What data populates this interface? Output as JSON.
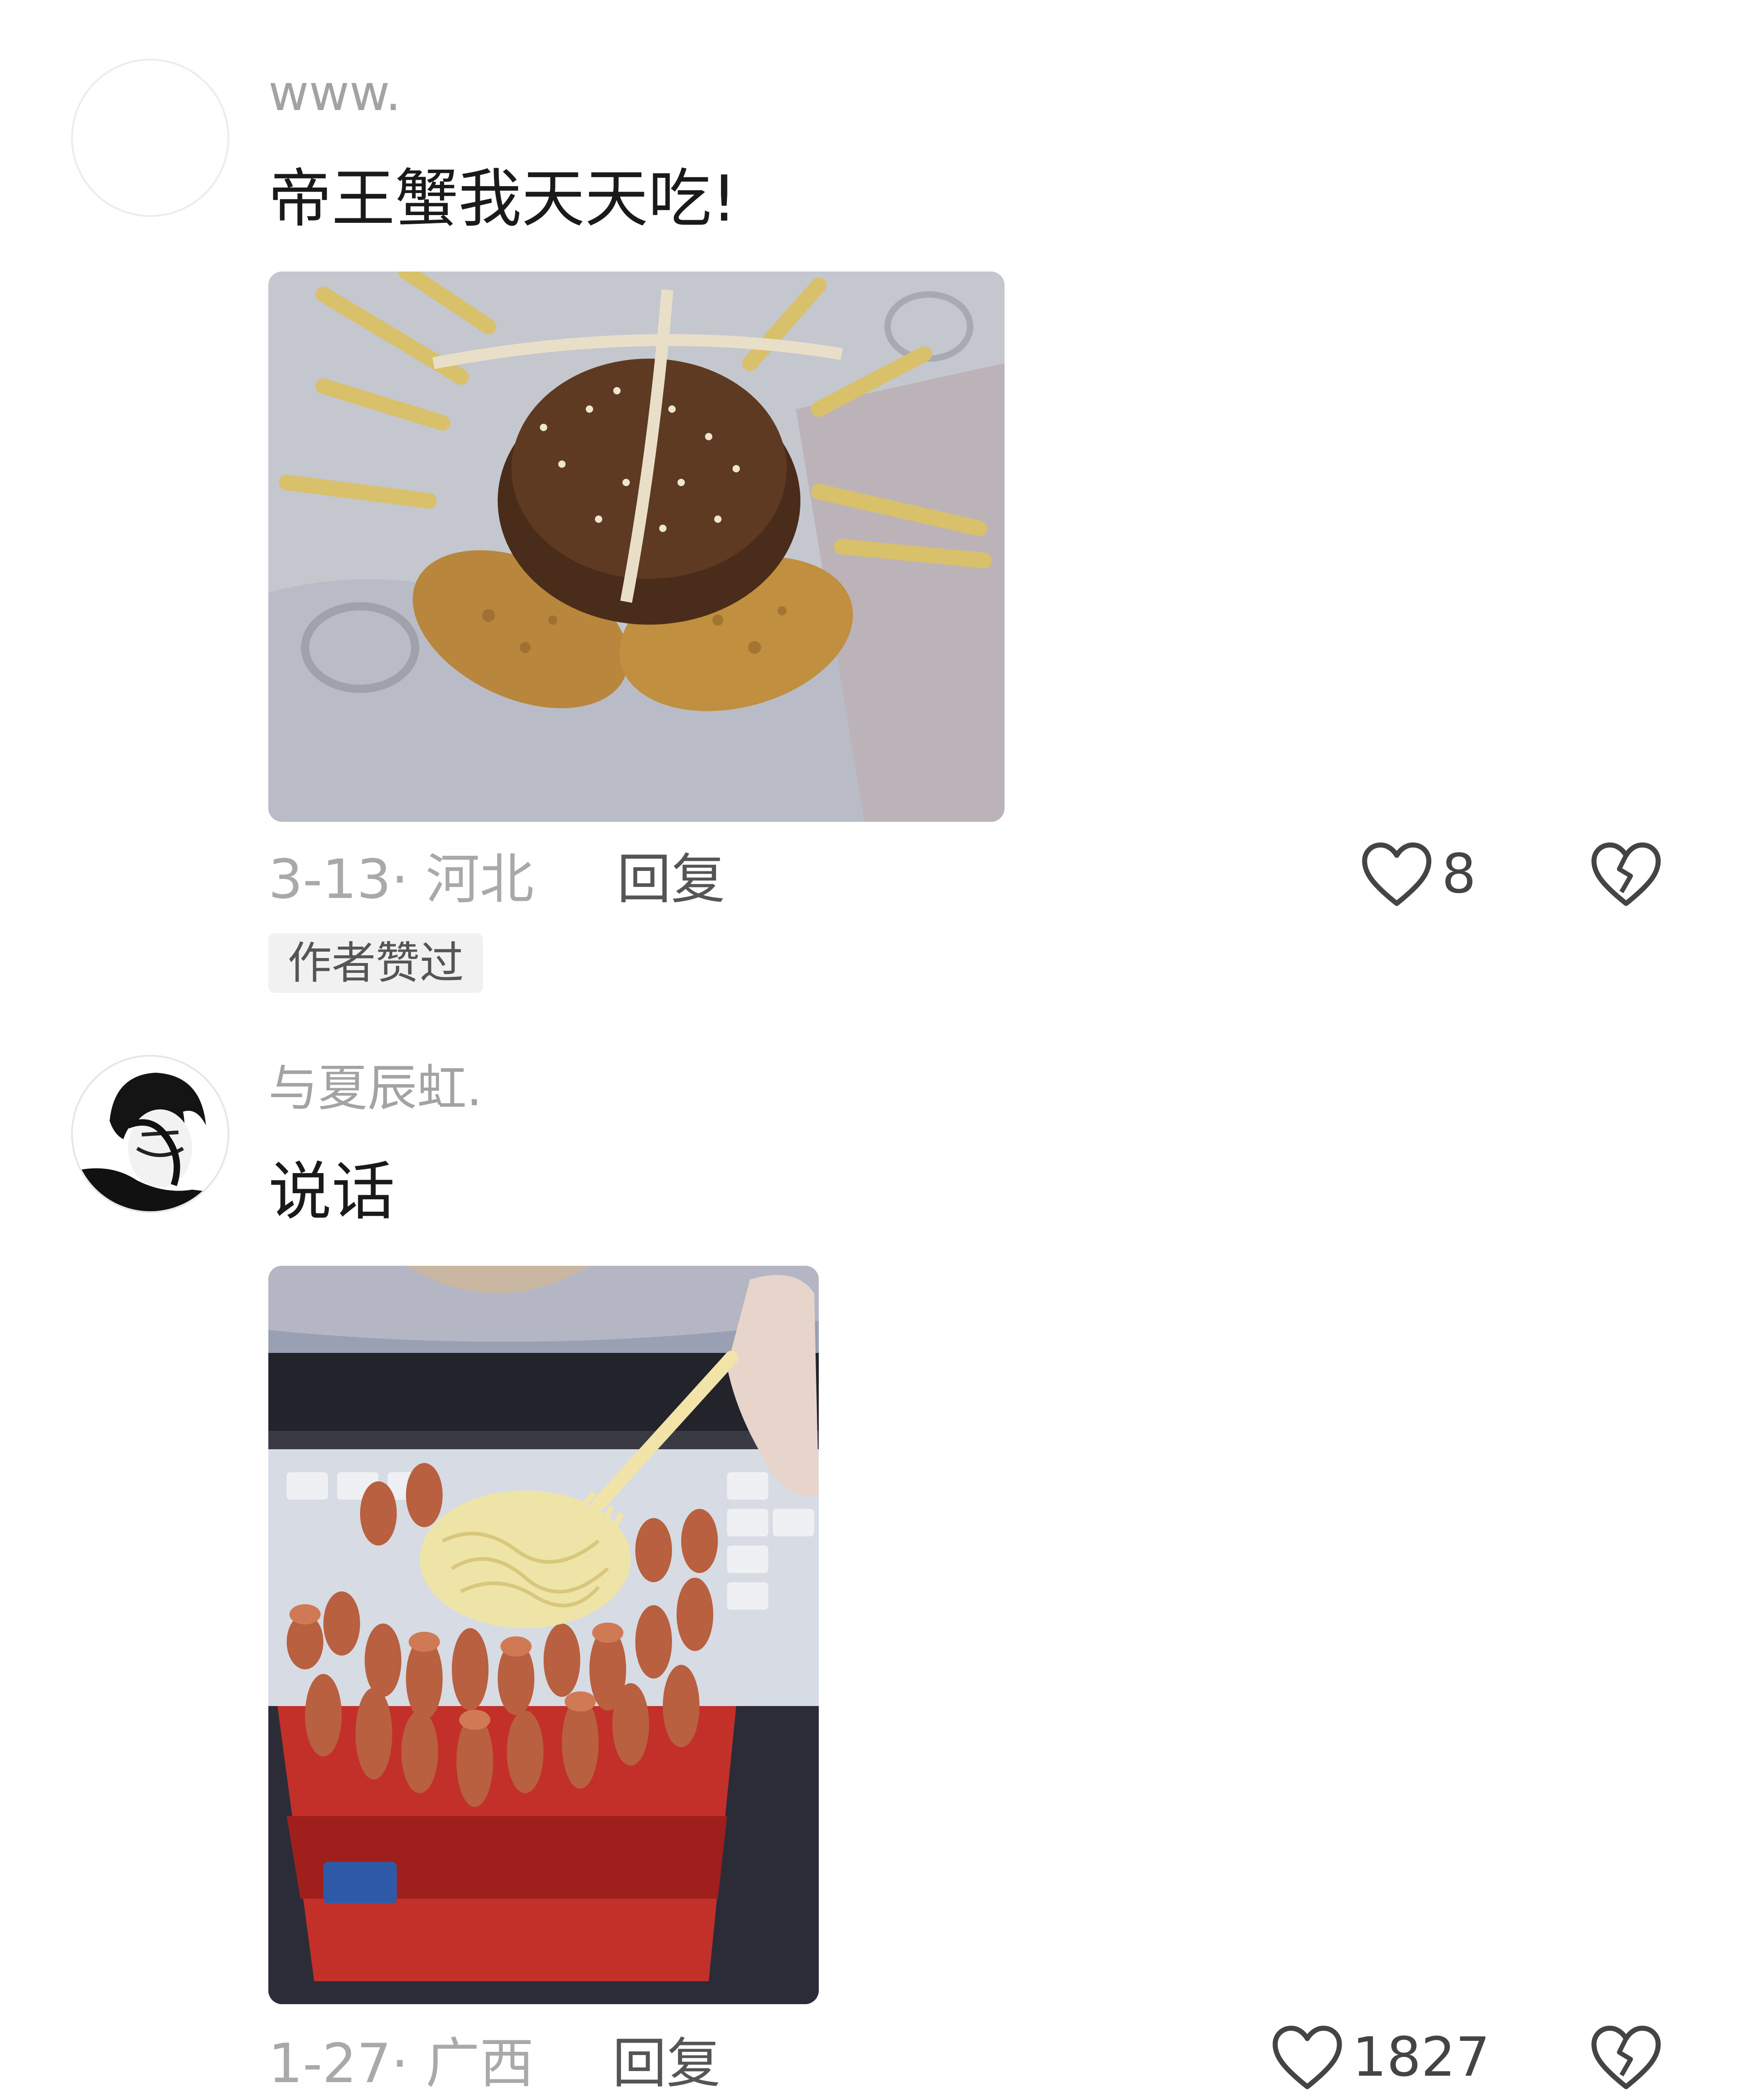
{
  "comments": [
    {
      "username": "www.",
      "text": "帝王蟹我天天吃!",
      "date": "3-13",
      "separator": "·",
      "location": "河北",
      "reply_label": "回复",
      "like_count": "8",
      "badge": "作者赞过",
      "avatar": "blank-avatar",
      "photo": "burger-crab-photo"
    },
    {
      "username": "与夏辰虹.",
      "text": "说话",
      "date": "1-27",
      "separator": "·",
      "location": "广西",
      "reply_label": "回复",
      "like_count": "1827",
      "avatar": "sketch-portrait-avatar",
      "photo": "noodle-sausage-cup-photo"
    }
  ],
  "icons": {
    "like": "heart-outline-icon",
    "dislike": "broken-heart-icon"
  },
  "colors": {
    "username": "#a3a3a3",
    "text": "#1a1a1a",
    "meta": "#a9a9a9",
    "reply": "#555555",
    "icon": "#444444",
    "badge_bg": "#f1f1f1"
  }
}
